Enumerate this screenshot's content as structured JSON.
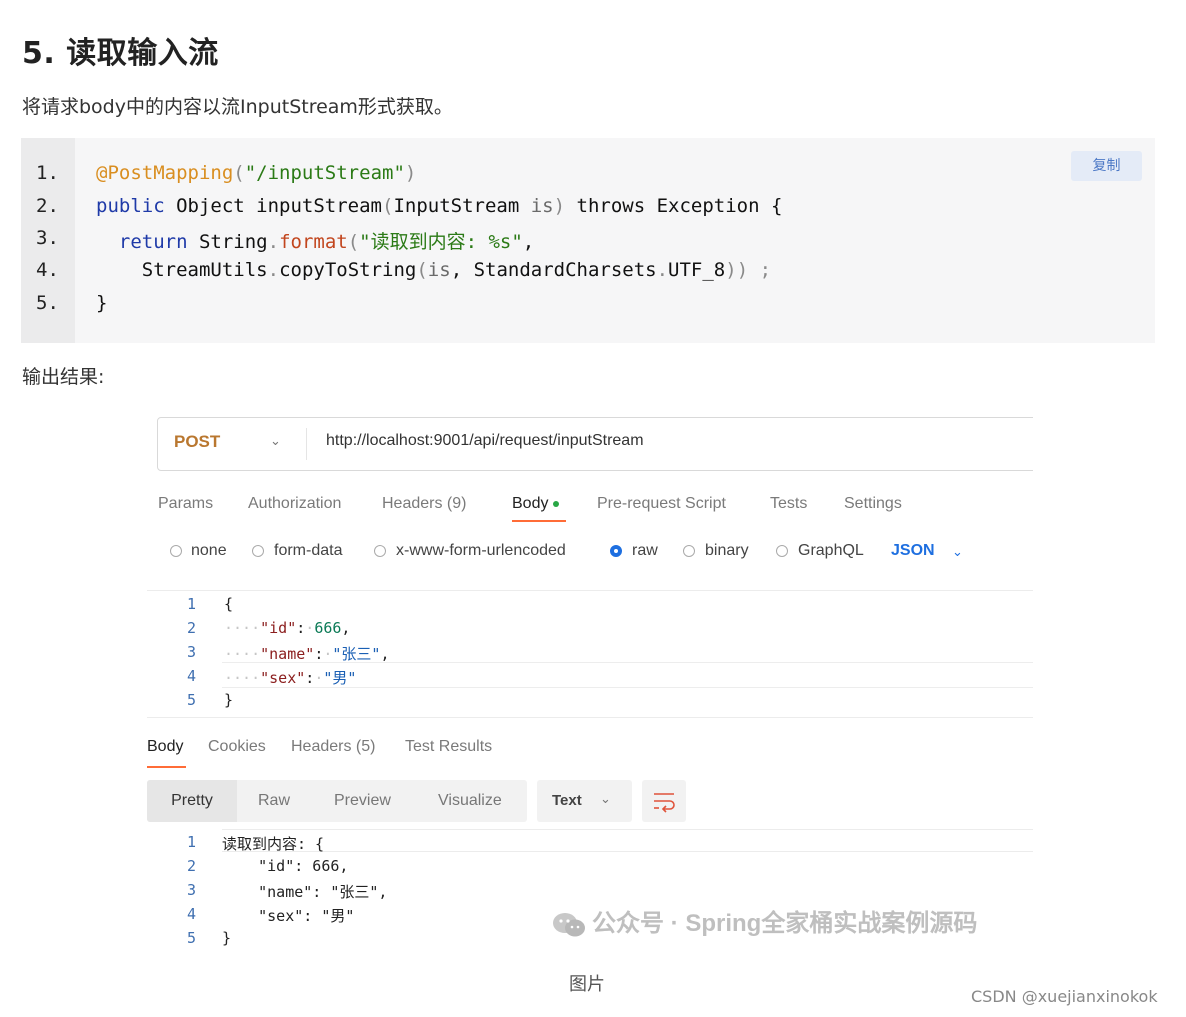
{
  "article": {
    "heading": "5. 读取输入流",
    "description": "将请求body中的内容以流InputStream形式获取。",
    "copy_label": "复制",
    "line_numbers": [
      "1.",
      "2.",
      "3.",
      "4.",
      "5."
    ],
    "code": {
      "l1_ann": "@PostMapping",
      "l1_p1": "(",
      "l1_str": "\"/inputStream\"",
      "l1_p2": ")",
      "l2_kw": "public",
      "l2_rest": " Object inputStream",
      "l2_p1": "(",
      "l2_param": "InputStream ",
      "l2_is": "is",
      "l2_p2": ")",
      "l2_tail": " throws Exception {",
      "l3_kw": "return",
      "l3_a": " String",
      "l3_dot": ".",
      "l3_fn": "format",
      "l3_p": "(",
      "l3_str": "\"读取到内容: %s\"",
      "l3_comma": ",",
      "l4_a": "StreamUtils",
      "l4_dot": ".",
      "l4_b": "copyToString",
      "l4_p1": "(",
      "l4_is": "is",
      "l4_c": ", StandardCharsets",
      "l4_dot2": ".",
      "l4_d": "UTF_8",
      "l4_p2": ")) ;",
      "l5": "}"
    },
    "output_label": "输出结果:",
    "caption": "图片",
    "csdn_credit": "CSDN @xuejianxinokok"
  },
  "postman": {
    "method": "POST",
    "url": "http://localhost:9001/api/request/inputStream",
    "request_tabs": [
      "Params",
      "Authorization",
      "Headers (9)",
      "Body",
      "Pre-request Script",
      "Tests",
      "Settings"
    ],
    "body_types": [
      "none",
      "form-data",
      "x-www-form-urlencoded",
      "raw",
      "binary",
      "GraphQL"
    ],
    "selected_body_type": "raw",
    "format": "JSON",
    "request_body": {
      "line_numbers": [
        "1",
        "2",
        "3",
        "4",
        "5"
      ],
      "open": "{",
      "k1": "\"id\"",
      "v1": "666",
      "k2": "\"name\"",
      "v2": "\"张三\"",
      "k3": "\"sex\"",
      "v3": "\"男\"",
      "close": "}",
      "colon": ":",
      "comma": ","
    },
    "response_tabs": [
      "Body",
      "Cookies",
      "Headers (5)",
      "Test Results"
    ],
    "view_modes": [
      "Pretty",
      "Raw",
      "Preview",
      "Visualize"
    ],
    "response_format": "Text",
    "response_body": {
      "line_numbers": [
        "1",
        "2",
        "3",
        "4",
        "5"
      ],
      "lines": [
        "读取到内容: {",
        "    \"id\": 666,",
        "    \"name\": \"张三\",",
        "    \"sex\": \"男\"",
        "}"
      ]
    },
    "watermark": "公众号 · Spring全家桶实战案例源码"
  }
}
